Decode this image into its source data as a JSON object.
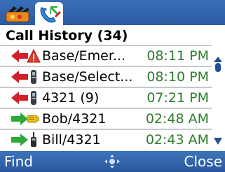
{
  "tabs": [
    {
      "icon": "contacts-tab-icon",
      "active": false
    },
    {
      "icon": "call-history-tab-icon",
      "active": true
    }
  ],
  "header": {
    "title": "Call History (34)"
  },
  "calls": [
    {
      "direction": "missed",
      "device": "alert-icon",
      "name": "Base/Emer...",
      "time": "08:11 PM"
    },
    {
      "direction": "missed",
      "device": "handset-icon",
      "name": "Base/Select...",
      "time": "08:10 PM"
    },
    {
      "direction": "missed",
      "device": "handset-icon",
      "name": "4321 (9)",
      "time": "07:21 PM"
    },
    {
      "direction": "outgoing",
      "device": "speaker-icon",
      "name": "Bob/4321",
      "time": "02:48 AM"
    },
    {
      "direction": "outgoing",
      "device": "walkie-icon",
      "name": "Bill/4321",
      "time": "02:43 AM"
    }
  ],
  "softkeys": {
    "left": "Find",
    "right": "Close"
  },
  "colors": {
    "bar": "#2b5aa0",
    "time": "#2f7d2f",
    "missed_arrow": "#d4202b",
    "outgoing_arrow": "#2fa83a"
  }
}
